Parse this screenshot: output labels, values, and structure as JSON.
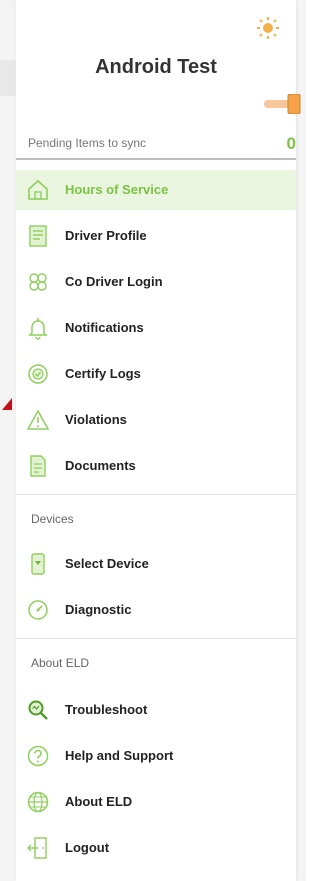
{
  "header": {
    "title": "Android Test"
  },
  "pending": {
    "label": "Pending Items to sync",
    "count": "0"
  },
  "menu_main": [
    {
      "label": "Hours of Service",
      "icon": "home-icon",
      "active": true
    },
    {
      "label": "Driver Profile",
      "icon": "profile-card-icon"
    },
    {
      "label": "Co Driver Login",
      "icon": "co-driver-icon"
    },
    {
      "label": "Notifications",
      "icon": "bell-icon"
    },
    {
      "label": "Certify Logs",
      "icon": "certify-badge-icon"
    },
    {
      "label": "Violations",
      "icon": "warning-icon"
    },
    {
      "label": "Documents",
      "icon": "document-icon"
    }
  ],
  "devices": {
    "section_label": "Devices",
    "items": [
      {
        "label": "Select Device",
        "icon": "device-select-icon"
      },
      {
        "label": "Diagnostic",
        "icon": "gauge-icon"
      }
    ]
  },
  "about": {
    "section_label": "About ELD",
    "items": [
      {
        "label": "Troubleshoot",
        "icon": "troubleshoot-search-icon"
      },
      {
        "label": "Help and Support",
        "icon": "help-icon"
      },
      {
        "label": "About ELD",
        "icon": "globe-icon"
      },
      {
        "label": "Logout",
        "icon": "logout-door-icon"
      }
    ]
  },
  "colors": {
    "accent": "#7cc243",
    "active_bg": "#eaf5e0",
    "arrow": "#c0121d"
  }
}
